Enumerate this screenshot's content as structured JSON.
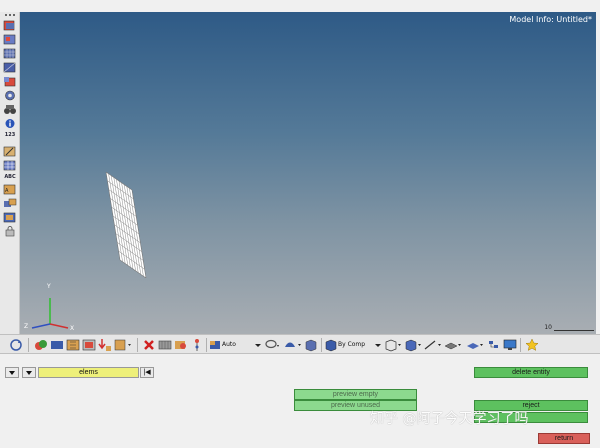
{
  "viewport": {
    "model_info": "Model Info: Untitled*",
    "scale_label": "10",
    "background_top": "#2e5a86",
    "background_bottom": "#a9aeb3"
  },
  "left_toolbar": {
    "icons": [
      "model-browser-icon",
      "collectors-icon",
      "mesh-icon",
      "elements-icon",
      "geometry-icon",
      "torus-icon",
      "binoculars-icon",
      "info-icon",
      "numbers-icon",
      "edit-icon",
      "grid-icon",
      "abc-icon",
      "tag-icon",
      "mask-icon",
      "component-icon",
      "lock-icon"
    ],
    "numbers_label": "123",
    "abc_label": "ABC"
  },
  "bottom_toolbar": {
    "auto_label": "Auto",
    "bycomp_label": "By Comp"
  },
  "panel": {
    "entity_selector": "elems",
    "reset_symbol": "|◀",
    "delete_entity": "delete entity",
    "preview_empty": "preview empty",
    "preview_unused": "preview unused",
    "reject": "reject",
    "return": "return",
    "watermark": "知乎 @阿子今天学习了吗",
    "accent_green": "#5dc15f",
    "accent_red": "#d9605a",
    "entity_field_color": "#eef07a"
  }
}
